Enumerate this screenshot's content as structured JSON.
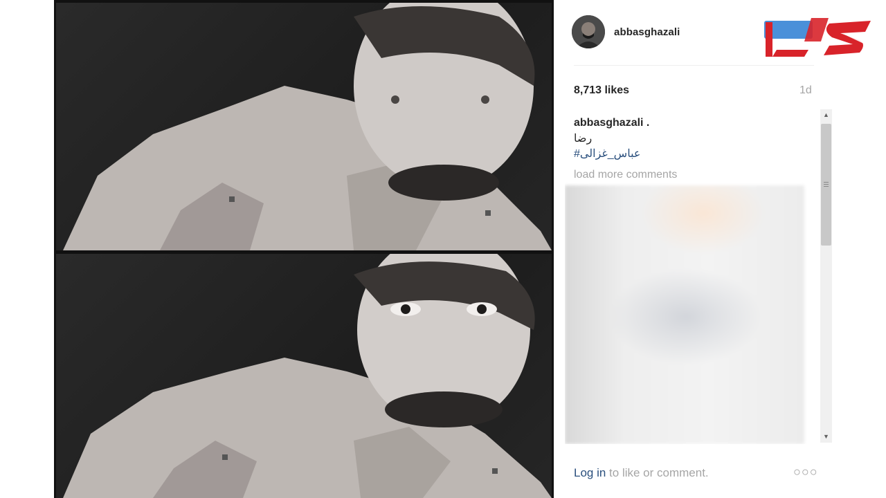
{
  "post": {
    "username": "abbasghazali",
    "likes": "8,713 likes",
    "time": "1d",
    "caption_user": "abbasghazali .",
    "caption_text": "رضا",
    "caption_tag": "#عباس_غزالی",
    "load_more": "load more comments",
    "footer_login": "Log in",
    "footer_rest": " to like or comment.",
    "more_options": "○○○"
  },
  "icons": {
    "avatar": "avatar",
    "logo": "brand-logo",
    "scroll_up": "scroll-up-arrow-icon",
    "scroll_down": "scroll-down-arrow-icon",
    "more": "more-options-icon"
  },
  "colors": {
    "link": "#2a4f7d",
    "muted": "#a5a5a5",
    "logo_red": "#d8232a",
    "logo_blue": "#4a90d9"
  }
}
